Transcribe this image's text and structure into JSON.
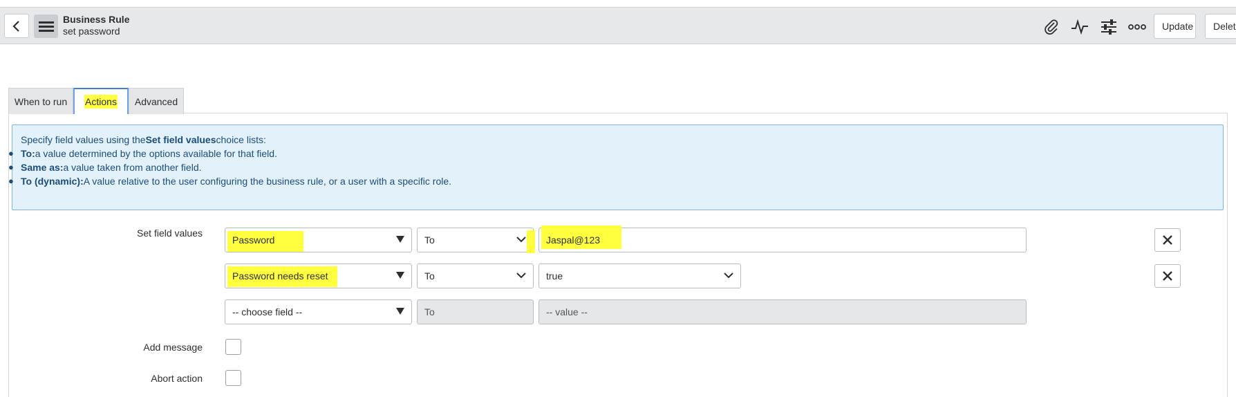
{
  "header": {
    "title": "Business Rule",
    "subtitle": "set password",
    "update_label": "Update",
    "delete_label": "Delet"
  },
  "tabs": [
    {
      "label": "When to run"
    },
    {
      "label": "Actions"
    },
    {
      "label": "Advanced"
    }
  ],
  "info": {
    "intro_prefix": "Specify field values using the",
    "intro_bold": "Set field values",
    "intro_suffix": "choice lists:",
    "items": [
      {
        "term": "To:",
        "text": "a value determined by the options available for that field."
      },
      {
        "term": "Same as:",
        "text": "a value taken from another field."
      },
      {
        "term": "To (dynamic):",
        "text": "A value relative to the user configuring the business rule, or a user with a specific role."
      }
    ]
  },
  "form": {
    "set_field_values_label": "Set field values",
    "rows": [
      {
        "field": "Password",
        "operator": "To",
        "value": "Jaspal@123"
      },
      {
        "field": "Password needs reset",
        "operator": "To",
        "value": "true"
      },
      {
        "field": "-- choose field --",
        "operator": "To",
        "value": "-- value --"
      }
    ],
    "add_message_label": "Add message",
    "abort_action_label": "Abort action"
  },
  "colors": {
    "highlight": "#ffff40",
    "accent": "#3b7ddd",
    "info_bg": "#e3f1fb"
  }
}
